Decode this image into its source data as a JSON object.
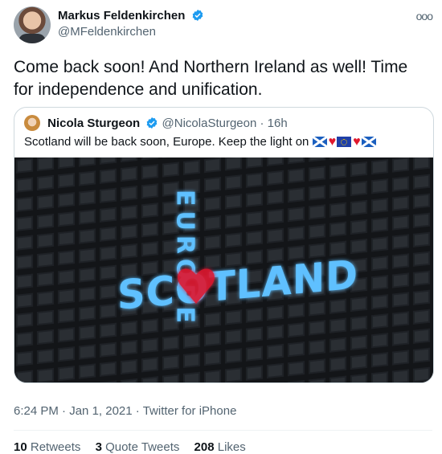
{
  "author": {
    "name": "Markus Feldenkirchen",
    "handle": "@MFeldenkirchen"
  },
  "more_label": "ooo",
  "tweet_text": "Come back soon! And Northern Ireland as well! Time for independence and unification.",
  "quoted": {
    "name": "Nicola Sturgeon",
    "handle": "@NicolaSturgeon",
    "separator": "·",
    "age": "16h",
    "text": "Scotland will be back soon, Europe. Keep the light on",
    "image": {
      "vertical_word": "EUROPE",
      "horizontal_word": "SCOTLAND"
    }
  },
  "meta": {
    "time": "6:24 PM",
    "date": "Jan 1, 2021",
    "source": "Twitter for iPhone",
    "separator": "·"
  },
  "stats": {
    "retweets_count": "10",
    "retweets_label": "Retweets",
    "quotes_count": "3",
    "quotes_label": "Quote Tweets",
    "likes_count": "208",
    "likes_label": "Likes"
  },
  "colors": {
    "verified": "#1d9bf0",
    "neon": "#4fb3ff",
    "heart": "#e0182d"
  }
}
